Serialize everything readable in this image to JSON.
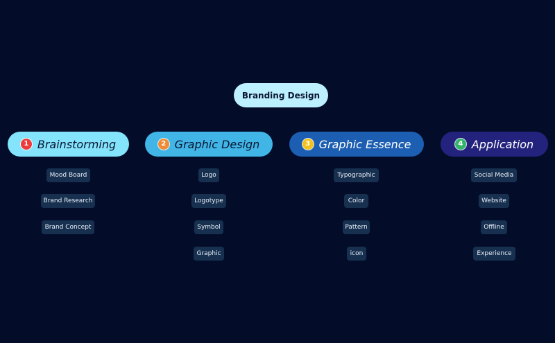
{
  "diagram": {
    "root": {
      "label": "Branding Design"
    },
    "branches": [
      {
        "number": "1",
        "label": "Brainstorming",
        "number_color": "#ee3b3b",
        "items": [
          "Mood Board",
          "Brand Research",
          "Brand Concept"
        ]
      },
      {
        "number": "2",
        "label": "Graphic Design",
        "number_color": "#f08b34",
        "items": [
          "Logo",
          "Logotype",
          "Symbol",
          "Graphic"
        ]
      },
      {
        "number": "3",
        "label": "Graphic Essence",
        "number_color": "#f3c11b",
        "items": [
          "Typographic",
          "Color",
          "Pattern",
          "icon"
        ]
      },
      {
        "number": "4",
        "label": "Application",
        "number_color": "#33b56b",
        "items": [
          "Social Media",
          "Website",
          "Offline",
          "Experience"
        ]
      }
    ]
  }
}
